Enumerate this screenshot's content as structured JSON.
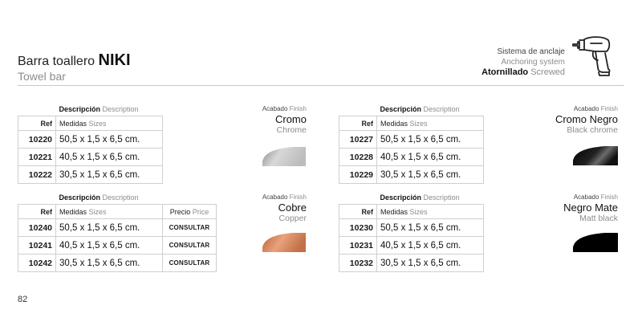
{
  "header": {
    "title_prefix": "Barra toallero",
    "title_name": "NIKI",
    "subtitle": "Towel bar",
    "anchoring": {
      "line1": "Sistema de anclaje",
      "line2": "Anchoring system",
      "type_es": "Atornillado",
      "type_en": "Screwed"
    }
  },
  "columns": {
    "desc_es": "Descripción",
    "desc_en": "Description",
    "ref": "Ref",
    "sizes_es": "Medidas",
    "sizes_en": "Sizes",
    "price_es": "Precio",
    "price_en": "Price"
  },
  "finish_label": {
    "es": "Acabado",
    "en": "Finish"
  },
  "blocks": [
    {
      "rows": [
        {
          "ref": "10220",
          "size": "50,5 x 1,5 x 6,5 cm."
        },
        {
          "ref": "10221",
          "size": "40,5 x 1,5 x 6,5 cm."
        },
        {
          "ref": "10222",
          "size": "30,5 x 1,5 x 6,5 cm."
        }
      ],
      "finish_es": "Cromo",
      "finish_en": "Chrome"
    },
    {
      "rows": [
        {
          "ref": "10227",
          "size": "50,5 x 1,5 x 6,5 cm."
        },
        {
          "ref": "10228",
          "size": "40,5 x 1,5 x 6,5 cm."
        },
        {
          "ref": "10229",
          "size": "30,5 x 1,5 x 6,5 cm."
        }
      ],
      "finish_es": "Cromo Negro",
      "finish_en": "Black chrome"
    },
    {
      "rows": [
        {
          "ref": "10240",
          "size": "50,5 x 1,5 x 6,5 cm.",
          "price": "CONSULTAR"
        },
        {
          "ref": "10241",
          "size": "40,5 x 1,5 x 6,5 cm.",
          "price": "CONSULTAR"
        },
        {
          "ref": "10242",
          "size": "30,5 x 1,5 x 6,5 cm.",
          "price": "CONSULTAR"
        }
      ],
      "finish_es": "Cobre",
      "finish_en": "Copper"
    },
    {
      "rows": [
        {
          "ref": "10230",
          "size": "50,5 x 1,5 x 6,5 cm."
        },
        {
          "ref": "10231",
          "size": "40,5 x 1,5 x 6,5 cm."
        },
        {
          "ref": "10232",
          "size": "30,5 x 1,5 x 6,5 cm."
        }
      ],
      "finish_es": "Negro Mate",
      "finish_en": "Matt black"
    }
  ],
  "page_number": "82",
  "icons": {
    "anchoring": "drill-icon"
  }
}
